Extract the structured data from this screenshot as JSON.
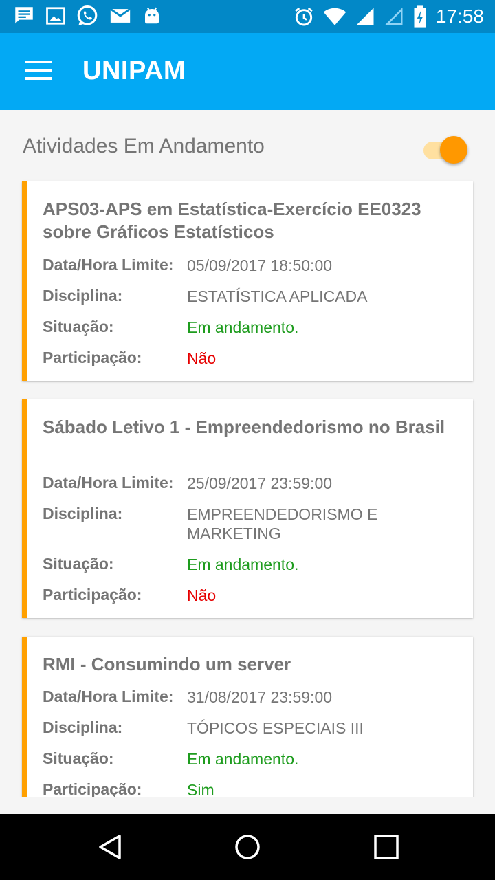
{
  "status_bar": {
    "time": "17:58",
    "left_icons": [
      "message-icon",
      "image-icon",
      "whatsapp-icon",
      "mail-icon",
      "android-icon"
    ],
    "right_icons": [
      "alarm-icon",
      "wifi-icon",
      "signal-icon",
      "signal-empty-icon",
      "battery-charging-icon"
    ]
  },
  "app_bar": {
    "title": "UNIPAM"
  },
  "section": {
    "title": "Atividades Em Andamento",
    "toggle_on": true
  },
  "labels": {
    "deadline": "Data/Hora Limite:",
    "discipline": "Disciplina:",
    "status": "Situação:",
    "participation": "Participação:"
  },
  "activities": [
    {
      "title": "APS03-APS em Estatística-Exercício EE0323 sobre Gráficos Estatísticos",
      "deadline": "05/09/2017  18:50:00",
      "discipline": "ESTATÍSTICA APLICADA",
      "status": "Em andamento.",
      "participation": "Não"
    },
    {
      "title": "Sábado Letivo 1 - Empreendedorismo no Brasil",
      "deadline": "25/09/2017  23:59:00",
      "discipline": "EMPREENDEDORISMO E MARKETING",
      "status": "Em andamento.",
      "participation": "Não"
    },
    {
      "title": "RMI - Consumindo um server",
      "deadline": "31/08/2017  23:59:00",
      "discipline": "TÓPICOS ESPECIAIS III",
      "status": "Em andamento.",
      "participation": "Sim"
    }
  ],
  "colors": {
    "status_bar": "#0288c7",
    "app_bar": "#03a9f4",
    "accent": "#ffa000",
    "status_green": "#1e9c1e",
    "participation_red": "#e60000",
    "participation_green": "#1e9c1e"
  },
  "nav_bar": {
    "buttons": [
      "back-icon",
      "home-icon",
      "recents-icon"
    ]
  }
}
